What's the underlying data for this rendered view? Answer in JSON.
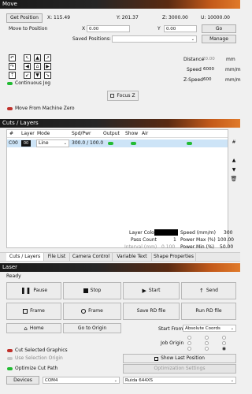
{
  "move": {
    "title": "Move",
    "get_position": "Get Position",
    "x_readout": "X: 115.49",
    "y_readout": "Y: 201.37",
    "z_readout": "Z: 3000.00",
    "u_readout": "U: 10000.00",
    "move_to_position": "Move to Position",
    "x_label": "X",
    "x_value": "0.00",
    "y_label": "Y",
    "y_value": "0.00",
    "go": "Go",
    "saved_positions": "Saved Positions:",
    "manage": "Manage",
    "distance_label": "Distance",
    "distance_value": "20.00",
    "distance_unit": "mm",
    "speed_label": "Speed",
    "speed_value": "6000",
    "speed_unit": "mm/m",
    "zspeed_label": "Z-Speed",
    "zspeed_value": "600",
    "zspeed_unit": "mm/m",
    "continuous_jog": "Continuous Jog",
    "focus_z": "Focus Z",
    "move_from_zero": "Move From Machine Zero"
  },
  "cuts": {
    "title": "Cuts / Layers",
    "columns": [
      "#",
      "Layer",
      "Mode",
      "Spd/Pwr",
      "Output",
      "Show",
      "Air"
    ],
    "rows": [
      {
        "num": "C00",
        "layer": "00",
        "mode": "Line",
        "spd_pwr": "300.0 / 100.0"
      }
    ],
    "layer_color": "Layer Color",
    "speed_mm": "Speed (mm/m)",
    "speed_mm_value": "300",
    "pass_count": "Pass Count",
    "pass_count_value": "1",
    "power_max": "Power Max (%)",
    "power_max_value": "100.00",
    "interval": "Interval (mm)",
    "interval_value": "0.100",
    "power_min": "Power Min (%)",
    "power_min_value": "50.00",
    "side_buttons": [
      "#",
      "▲",
      "▼",
      "🗑"
    ]
  },
  "tabs": [
    "Cuts / Layers",
    "File List",
    "Camera Control",
    "Variable Text",
    "Shape Properties"
  ],
  "laser": {
    "title": "Laser",
    "status": "Ready",
    "pause": "Pause",
    "stop": "Stop",
    "start": "Start",
    "send": "Send",
    "frame1": "Frame",
    "frame2": "Frame",
    "save_rd": "Save RD file",
    "run_rd": "Run RD file",
    "home": "Home",
    "go_to_origin": "Go to Origin",
    "start_from_label": "Start From:",
    "start_from_value": "Absolute Coords",
    "job_origin": "Job Origin",
    "cut_selected": "Cut Selected Graphics",
    "use_selection_origin": "Use Selection Origin",
    "optimize_cut_path": "Optimize Cut Path",
    "show_last_position": "Show Last Position",
    "optimization_settings": "Optimization Settings",
    "devices": "Devices",
    "port": "COM4",
    "controller": "Ruida 644XS"
  }
}
